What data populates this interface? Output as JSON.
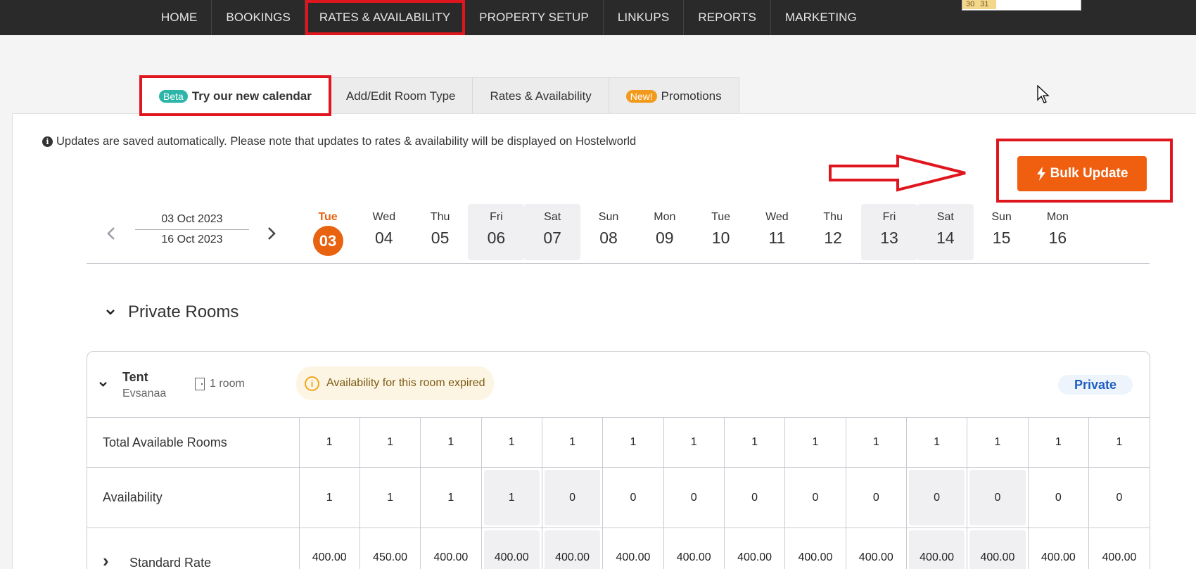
{
  "nav": {
    "items": [
      "HOME",
      "BOOKINGS",
      "RATES & AVAILABILITY",
      "PROPERTY SETUP",
      "LINKUPS",
      "REPORTS",
      "MARKETING"
    ],
    "active_index": 2
  },
  "mini_calendar": {
    "d1": "30",
    "d2": "31"
  },
  "tabs": {
    "calendar": {
      "badge": "Beta",
      "label": "Try our new calendar"
    },
    "room_type": {
      "label": "Add/Edit Room Type"
    },
    "rates": {
      "label": "Rates & Availability"
    },
    "promotions": {
      "badge": "New!",
      "label": "Promotions"
    }
  },
  "notice": "Updates are saved automatically. Please note that updates to rates & availability will be displayed on Hostelworld",
  "bulk_update_label": "Bulk Update",
  "range": {
    "from": "03 Oct 2023",
    "to": "16 Oct 2023"
  },
  "days": [
    {
      "name": "Tue",
      "num": "03",
      "today": true,
      "weekend": false
    },
    {
      "name": "Wed",
      "num": "04",
      "weekend": false
    },
    {
      "name": "Thu",
      "num": "05",
      "weekend": false
    },
    {
      "name": "Fri",
      "num": "06",
      "weekend": true
    },
    {
      "name": "Sat",
      "num": "07",
      "weekend": true
    },
    {
      "name": "Sun",
      "num": "08",
      "weekend": false
    },
    {
      "name": "Mon",
      "num": "09",
      "weekend": false
    },
    {
      "name": "Tue",
      "num": "10",
      "weekend": false
    },
    {
      "name": "Wed",
      "num": "11",
      "weekend": false
    },
    {
      "name": "Thu",
      "num": "12",
      "weekend": false
    },
    {
      "name": "Fri",
      "num": "13",
      "weekend": true
    },
    {
      "name": "Sat",
      "num": "14",
      "weekend": true
    },
    {
      "name": "Sun",
      "num": "15",
      "weekend": false
    },
    {
      "name": "Mon",
      "num": "16",
      "weekend": false
    }
  ],
  "section_title": "Private Rooms",
  "room": {
    "name": "Tent",
    "subtitle": "Evsanaa",
    "count": "1 room",
    "expired_notice": "Availability for this room expired",
    "type_badge": "Private"
  },
  "rows": [
    {
      "label": "Total Available Rooms",
      "values": [
        "1",
        "1",
        "1",
        "1",
        "1",
        "1",
        "1",
        "1",
        "1",
        "1",
        "1",
        "1",
        "1",
        "1"
      ]
    },
    {
      "label": "Availability",
      "values": [
        "1",
        "1",
        "1",
        "1",
        "0",
        "0",
        "0",
        "0",
        "0",
        "0",
        "0",
        "0",
        "0",
        "0"
      ]
    },
    {
      "label": "Standard Rate",
      "values": [
        "400.00",
        "450.00",
        "400.00",
        "400.00",
        "400.00",
        "400.00",
        "400.00",
        "400.00",
        "400.00",
        "400.00",
        "400.00",
        "400.00",
        "400.00",
        "400.00"
      ]
    }
  ],
  "colors": {
    "accent": "#ef5f0f",
    "highlight": "#e0161e",
    "nav_bg": "#2a2a2a"
  }
}
